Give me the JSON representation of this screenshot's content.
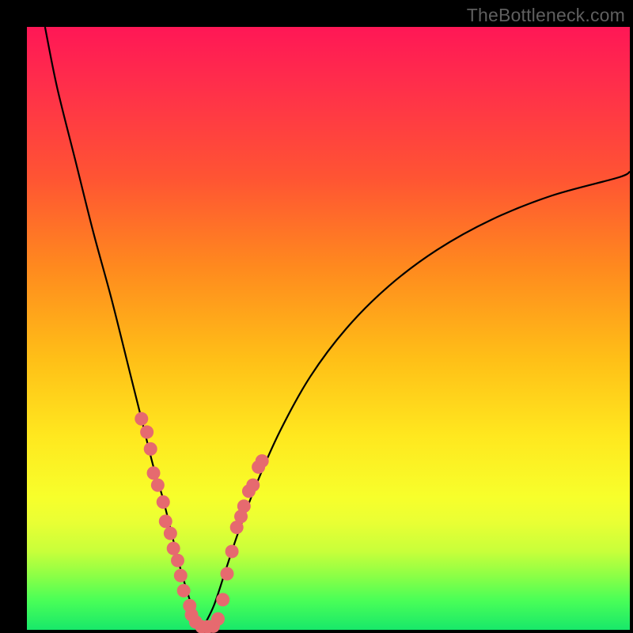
{
  "watermark": "TheBottleneck.com",
  "chart_data": {
    "type": "line",
    "title": "",
    "xlabel": "",
    "ylabel": "",
    "xlim": [
      0,
      100
    ],
    "ylim": [
      0,
      100
    ],
    "grid": false,
    "legend": false,
    "note": "Two curves forming a V shape; y-axis = bottleneck % (high=red top, low=green bottom); scattered pink markers sit near the valley on both arms.",
    "series": [
      {
        "name": "left-curve",
        "x": [
          3,
          5,
          8,
          11,
          14,
          17,
          19,
          21,
          22.5,
          24,
          25.5,
          27,
          28,
          29
        ],
        "y": [
          100,
          90,
          78,
          66,
          55,
          43,
          35,
          27,
          22,
          16,
          10,
          5,
          2,
          0
        ]
      },
      {
        "name": "right-curve",
        "x": [
          29,
          31,
          33,
          35,
          38,
          42,
          47,
          53,
          60,
          68,
          77,
          87,
          98,
          100
        ],
        "y": [
          0,
          4,
          10,
          16,
          24,
          33,
          42,
          50,
          57,
          63,
          68,
          72,
          75,
          76
        ]
      }
    ],
    "points": {
      "name": "scatter",
      "color": "#e66a6f",
      "xy": [
        [
          19.0,
          35.0
        ],
        [
          19.9,
          32.8
        ],
        [
          20.5,
          30.0
        ],
        [
          21.0,
          26.0
        ],
        [
          21.7,
          24.0
        ],
        [
          22.6,
          21.2
        ],
        [
          23.0,
          18.0
        ],
        [
          23.8,
          16.0
        ],
        [
          24.3,
          13.5
        ],
        [
          25.0,
          11.5
        ],
        [
          25.5,
          9.0
        ],
        [
          26.0,
          6.5
        ],
        [
          27.0,
          4.0
        ],
        [
          27.3,
          2.5
        ],
        [
          28.0,
          1.3
        ],
        [
          29.0,
          0.5
        ],
        [
          30.0,
          0.5
        ],
        [
          30.9,
          0.6
        ],
        [
          31.7,
          1.8
        ],
        [
          32.5,
          5.0
        ],
        [
          33.2,
          9.3
        ],
        [
          34.0,
          13.0
        ],
        [
          34.8,
          17.0
        ],
        [
          35.5,
          18.8
        ],
        [
          36.0,
          20.5
        ],
        [
          36.8,
          23.0
        ],
        [
          37.5,
          24.0
        ],
        [
          38.4,
          27.0
        ],
        [
          39.0,
          28.0
        ]
      ]
    }
  }
}
